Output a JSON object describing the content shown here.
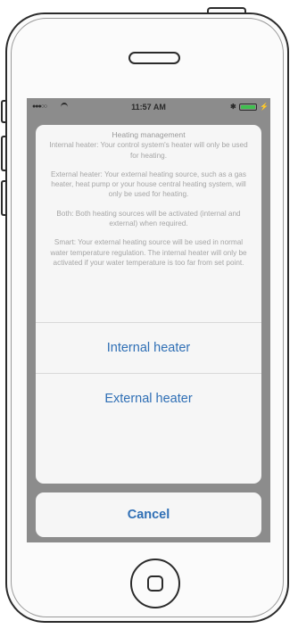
{
  "status_bar": {
    "signal": "●●●○○",
    "wifi_icon": "wifi-icon",
    "time": "11:57 AM",
    "bluetooth": "✱",
    "battery_color": "#3fbf4f",
    "charging": "⚡"
  },
  "action_sheet": {
    "title": "Heating management",
    "paragraphs": [
      "Internal heater: Your control system's heater will only be used for heating.",
      "External heater: Your external heating source, such as a gas heater, heat pump or your house central heating system, will only be used for heating.",
      "Both: Both heating sources will be activated (internal and external) when required.",
      "Smart: Your external heating source will be used in normal water temperature regulation. The internal heater will only be activated if your water temperature is too far from set point."
    ],
    "buttons": [
      "Internal heater",
      "External heater"
    ],
    "cancel_label": "Cancel",
    "accent_color": "#2f6fb5"
  }
}
